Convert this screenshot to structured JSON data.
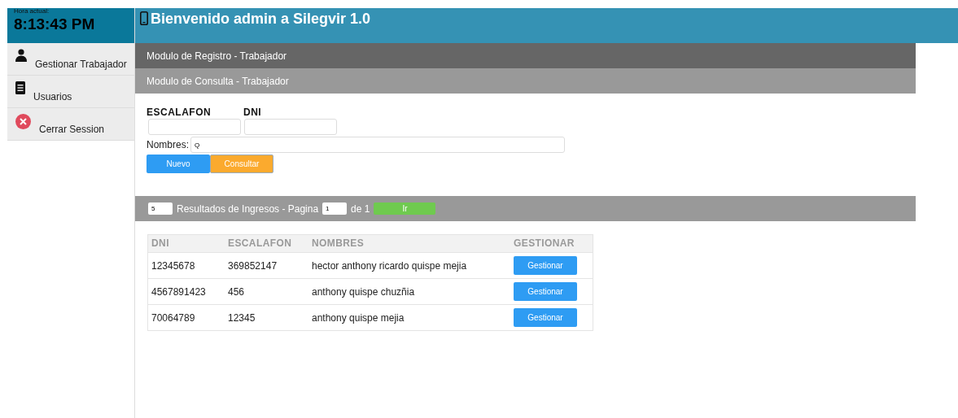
{
  "clock": {
    "label": "Hora actual:",
    "time": "8:13:43 PM"
  },
  "header": {
    "title": "Bienvenido admin a Silegvir 1.0"
  },
  "sidebar": {
    "items": [
      {
        "label": "Gestionar Trabajador",
        "kind": "person"
      },
      {
        "label": "Usuarios",
        "kind": "document"
      },
      {
        "label": "Cerrar Session",
        "kind": "logout"
      }
    ]
  },
  "modules": [
    {
      "label": "Modulo de Registro - Trabajador",
      "kind": "dark"
    },
    {
      "label": "Modulo de Consulta - Trabajador",
      "kind": "light"
    }
  ],
  "search": {
    "escalafon_label": "ESCALAFON",
    "dni_label": "DNI",
    "nombres_label": "Nombres:",
    "nombres_value": "Q",
    "buttons": [
      {
        "label": "Nuevo",
        "kind": "primary"
      },
      {
        "label": "Consultar",
        "kind": "warning"
      }
    ]
  },
  "results_bar": {
    "page_size": "5",
    "text": "Resultados de Ingresos - Pagina",
    "page": "1",
    "of_text": "de 1",
    "go_button": "Ir"
  },
  "table": {
    "columns": [
      "DNI",
      "ESCALAFON",
      "NOMBRES",
      "GESTIONAR"
    ],
    "rows": [
      {
        "dni": "12345678",
        "escalafon": "369852147",
        "nombres": "hector anthony ricardo quispe mejia",
        "action": "Gestionar"
      },
      {
        "dni": "4567891423",
        "escalafon": "456",
        "nombres": "anthony quispe chuzñia",
        "action": "Gestionar"
      },
      {
        "dni": "70064789",
        "escalafon": "12345",
        "nombres": "anthony quispe mejia",
        "action": "Gestionar"
      }
    ]
  }
}
